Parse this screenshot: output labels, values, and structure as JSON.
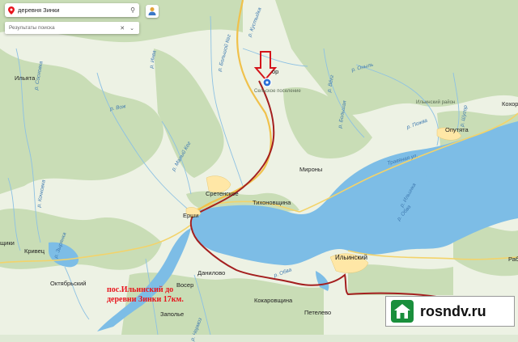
{
  "search": {
    "query": "деревня Зинки",
    "results_label": "Результаты поиска",
    "search_icon": "search-icon",
    "close_icon": "close-icon",
    "pin_icon": "map-pin-icon"
  },
  "colors": {
    "water": "#7dbde6",
    "forest": "#c4dbb1",
    "field": "#eef3e6",
    "route": "#9b1d1d",
    "marker_arrow": "#d4141a",
    "note_text": "#e8141c"
  },
  "places": {
    "ilyata": "Ильята",
    "sretenskoe": "Сретенское",
    "tikhonovshchina": "Тихоновщина",
    "mirony": "Мироны",
    "ershi": "Ерши",
    "krivets": "Кривец",
    "oktyabrsky": "Октябрьский",
    "danilovo": "Данилово",
    "voser": "Восер",
    "kokarovshchina": "Кокаровщина",
    "petelevo": "Петелево",
    "zapolye": "Заполье",
    "ilyinsky": "Ильинский",
    "oputyata": "Опутята",
    "kokhor": "Кохор",
    "rab": "Рабо",
    "shchiki": "щики",
    "zinki_small": "Сельское поселение",
    "zinki_road": "ор",
    "ilyinsky_district": "Ильинский район"
  },
  "rivers": {
    "obva_1": "р. Обва",
    "obva_2": "р. Обва",
    "chermoz": "р. Чермоз",
    "vizhai": "р. Вож",
    "travyanaya": "Травяная ул.",
    "ilyinka": "р. Ильинка",
    "kurmaika": "р. Кустыдка",
    "bolshoy_kheg": "р. Большой Кег",
    "maly_kheg": "р. Малый Кег",
    "pozhva": "р. Пожва",
    "onyl": "р. Оныль",
    "vyaga": "р. Вёгг",
    "bolshaya": "р. Большая",
    "shchugor": "р. Шугор",
    "inva": "р. Инва",
    "sosnovka": "р. Сосновка",
    "kochkovka": "р. Кочковка",
    "zyrianka": "р. Зырянка"
  },
  "note": {
    "line1": "пос.Ильинский до",
    "line2": "деревни Зинки 17км."
  },
  "badge": {
    "brand": "rosndv.ru",
    "icon": "house-logo-icon"
  }
}
